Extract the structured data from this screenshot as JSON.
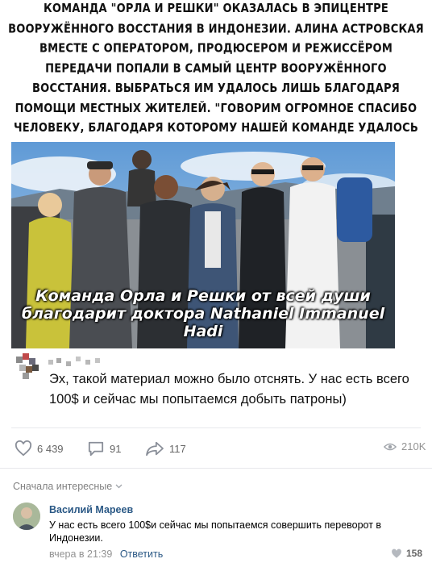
{
  "post": {
    "headline": "Команда \"Орла и решки\" оказалась в эпицентре вооружённого восстания в Индонезии. Алина Астровская вместе с оператором, продюсером и режиссёром передачи попали в самый центр вооружённого восстания. Выбраться им удалось лишь благодаря помощи местных жителей. \"Говорим огромное СПАСИБО человеку, благодаря которому нашей команде удалось эвакуироваться, — это Nathaniel Immanuel Hadi.»",
    "photo_caption_line1": "Команда Орла и Решки от всей души",
    "photo_caption_line2": "благодарит доктора Nathaniel Immanuel Hadi",
    "comment_text": "Эх, такой материал можно было отснять. У нас есть всего 100$ и сейчас мы попытаемся добыть патроны)"
  },
  "actions": {
    "likes": "6 439",
    "comments": "91",
    "shares": "117",
    "views": "210K"
  },
  "comments_section": {
    "sort_label": "Сначала интересные",
    "items": [
      {
        "author": "Василий Мареев",
        "text": "У нас есть всего 100$и сейчас мы попытаемся совершить переворот в Индонезии.",
        "time": "вчера в 21:39",
        "reply_label": "Ответить",
        "likes": "158"
      }
    ]
  },
  "colors": {
    "link": "#2a5885",
    "muted": "#828282",
    "separator": "#e7e8ec"
  }
}
